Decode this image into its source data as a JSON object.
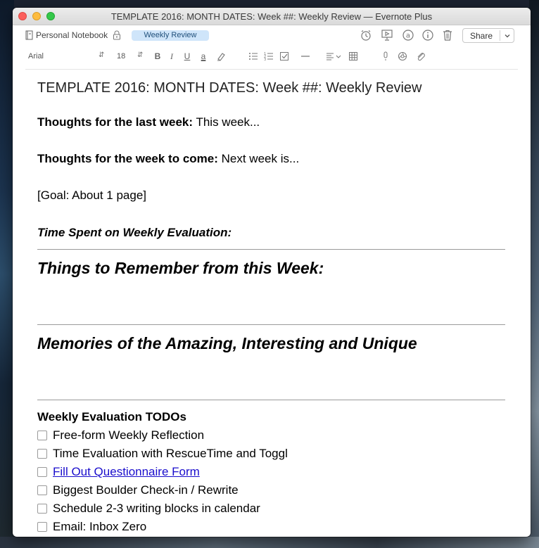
{
  "window": {
    "title": "TEMPLATE 2016: MONTH DATES: Week ##: Weekly Review — Evernote Plus"
  },
  "notebar": {
    "notebook": "Personal Notebook",
    "tag": "Weekly Review",
    "share_label": "Share"
  },
  "formatbar": {
    "font": "Arial",
    "size": "18",
    "bold": "B",
    "italic": "I",
    "underline": "U",
    "text_color": "a"
  },
  "note": {
    "title": "TEMPLATE 2016: MONTH DATES: Week ##: Weekly Review",
    "thoughts_last_label": "Thoughts for the last week:",
    "thoughts_last_text": " This week...",
    "thoughts_next_label": "Thoughts for the week to come:",
    "thoughts_next_text": " Next week is...",
    "goal": "[Goal: About 1 page]",
    "time_spent": "Time Spent on Weekly Evaluation:",
    "heading_remember": "Things to Remember from this Week:",
    "heading_memories": "Memories of the Amazing, Interesting and Unique",
    "todos_heading": "Weekly Evaluation TODOs",
    "todos": [
      {
        "label": "Free-form Weekly Reflection",
        "checked": false,
        "link": false
      },
      {
        "label": "Time Evaluation with RescueTime and Toggl",
        "checked": false,
        "link": false
      },
      {
        "label": "Fill Out Questionnaire Form",
        "checked": false,
        "link": true
      },
      {
        "label": "Biggest Boulder Check-in / Rewrite",
        "checked": false,
        "link": false
      },
      {
        "label": "Schedule 2-3 writing blocks in calendar",
        "checked": false,
        "link": false
      },
      {
        "label": "Email: Inbox Zero",
        "checked": false,
        "link": false
      }
    ]
  },
  "colors": {
    "tag_bg": "#cfe5fa",
    "link": "#1a0dcc"
  }
}
